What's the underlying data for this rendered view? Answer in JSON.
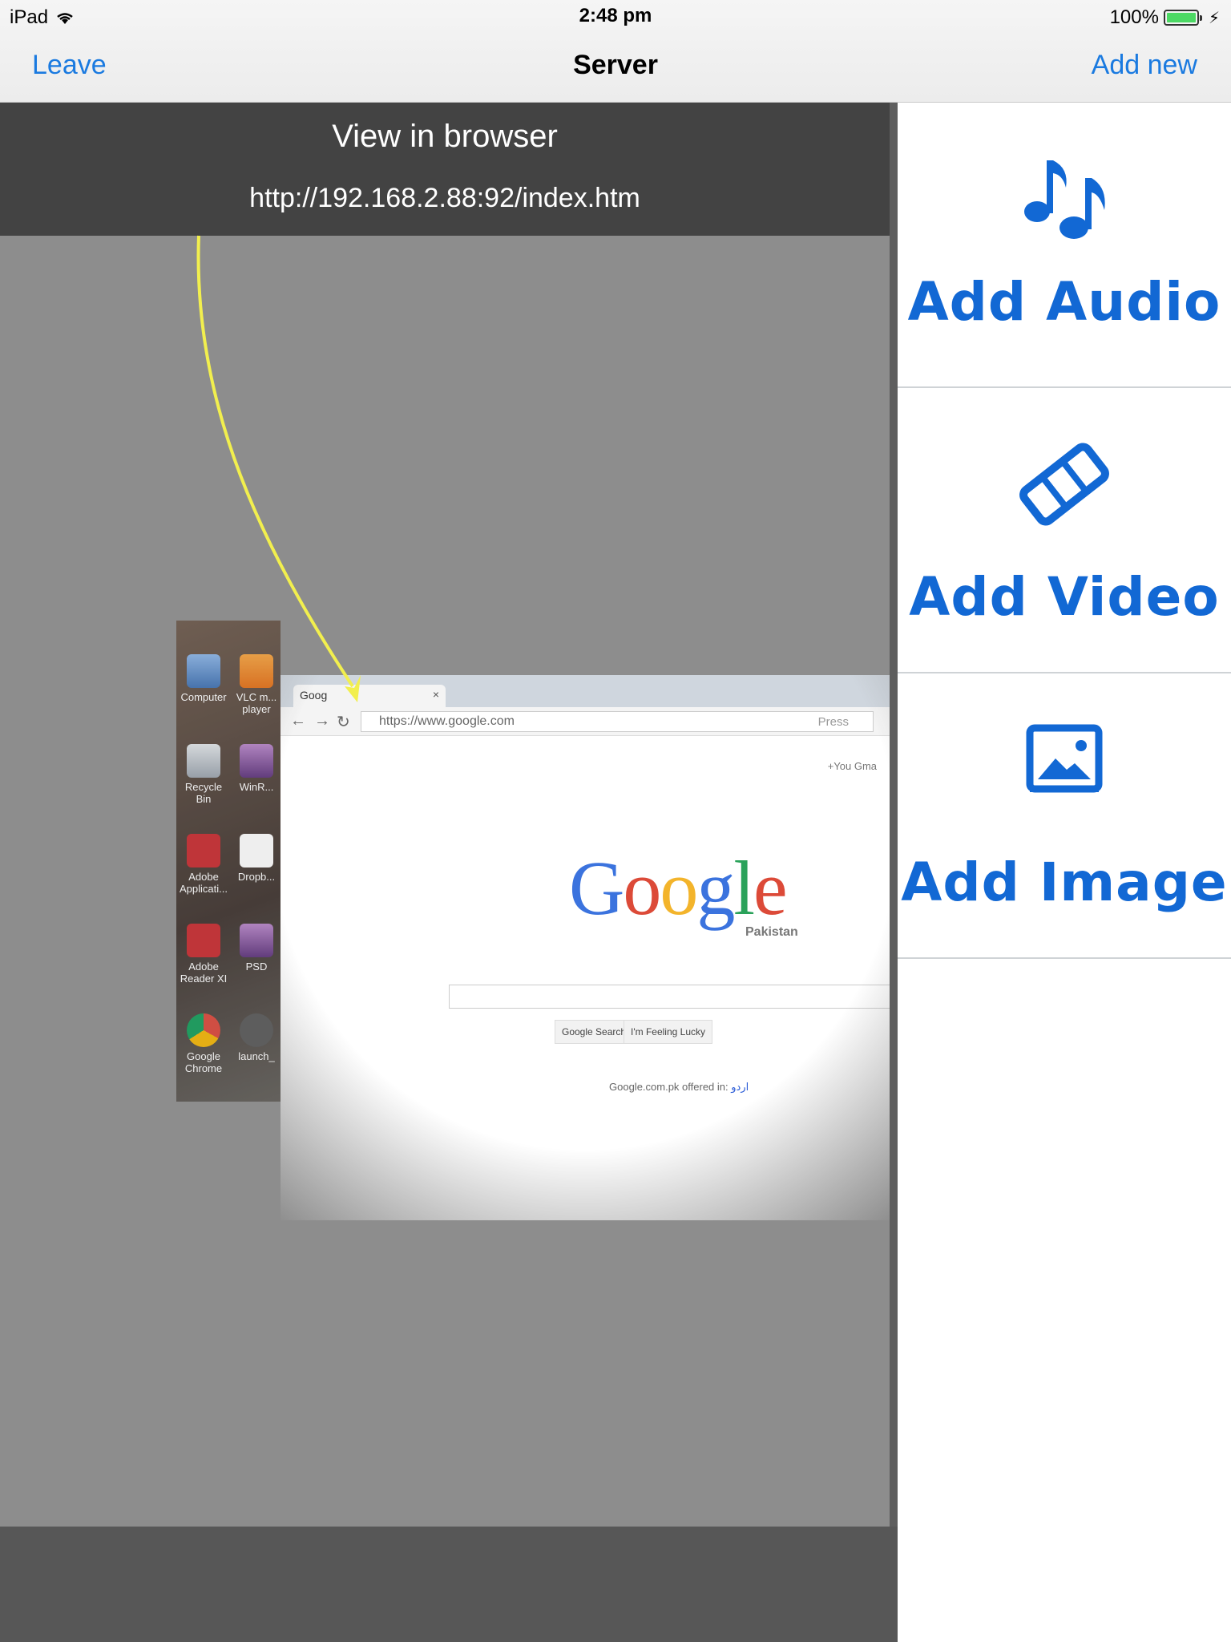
{
  "status_bar": {
    "device": "iPad",
    "time": "2:48 pm",
    "battery": "100%"
  },
  "nav": {
    "left_label": "Leave",
    "title": "Server",
    "right_label": "Add new"
  },
  "banner": {
    "title": "View in browser",
    "url": "http://192.168.2.88:92/index.htm"
  },
  "preview": {
    "desktop_icons": [
      {
        "label": "Computer"
      },
      {
        "label": "VLC m... player"
      },
      {
        "label": "Recycle Bin"
      },
      {
        "label": "WinR..."
      },
      {
        "label": "Adobe Applicati..."
      },
      {
        "label": "Dropb..."
      },
      {
        "label": "Adobe Reader XI"
      },
      {
        "label": "PSD"
      },
      {
        "label": "Google Chrome"
      },
      {
        "label": "launch_"
      }
    ],
    "tab_title": "Goog",
    "address": "https://www.google.com",
    "press_hint": "Press",
    "you_link": "+You  Gma",
    "logo_sub": "Pakistan",
    "search_button": "Google Search",
    "lucky_button": "I'm Feeling Lucky",
    "offered_in": "Google.com.pk offered in:",
    "offered_lang": "اردو"
  },
  "panel": {
    "items": [
      {
        "label": "Add Audio",
        "icon": "music-note-icon"
      },
      {
        "label": "Add Video",
        "icon": "film-strip-icon"
      },
      {
        "label": "Add Image",
        "icon": "image-icon"
      }
    ]
  },
  "colors": {
    "accent": "#1a7ae0",
    "panel_label": "#1268d4",
    "banner_bg": "#434343"
  }
}
